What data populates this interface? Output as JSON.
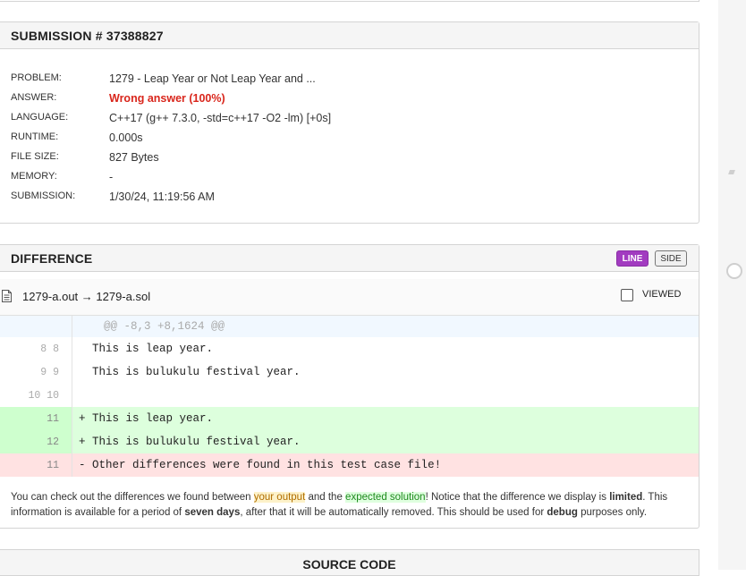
{
  "submission": {
    "title": "SUBMISSION # 37388827",
    "fields": [
      {
        "label": "PROBLEM:",
        "value": "1279 - Leap Year or Not Leap Year and ..."
      },
      {
        "label": "ANSWER:",
        "value": "Wrong answer (100%)"
      },
      {
        "label": "LANGUAGE:",
        "value": "C++17 (g++ 7.3.0, -std=c++17 -O2 -lm) [+0s]"
      },
      {
        "label": "RUNTIME:",
        "value": "0.000s"
      },
      {
        "label": "FILE SIZE:",
        "value": "827 Bytes"
      },
      {
        "label": "MEMORY:",
        "value": "-"
      },
      {
        "label": "SUBMISSION:",
        "value": "1/30/24, 11:19:56 AM"
      }
    ],
    "answer_color": "#d9261c"
  },
  "difference": {
    "title": "DIFFERENCE",
    "line_button": "LINE",
    "side_button": "SIDE",
    "file_label": "1279-a.out → 1279-a.sol",
    "viewed_label": "VIEWED",
    "hunk": "@@ -8,3 +8,1624 @@",
    "rows": [
      {
        "gutter": "8 8",
        "text": "  This is leap year."
      },
      {
        "gutter": "9 9",
        "text": "  This is bulukulu festival year."
      },
      {
        "gutter": "10 10",
        "text": ""
      },
      {
        "gutter": "11",
        "text": "+ This is leap year."
      },
      {
        "gutter": "12",
        "text": "+ This is bulukulu festival year."
      },
      {
        "gutter": "11",
        "text": "- Other differences were found in this test case file!"
      }
    ],
    "note": {
      "p1": "You can check out the differences we found between ",
      "your_output": "your output",
      "p2": " and the ",
      "expected": "expected solution",
      "p3": "! Notice that the difference we display is ",
      "limited": "limited",
      "p4": ". This information is available for a period of ",
      "seven_days": "seven days",
      "p5": ", after that it will be automatically removed. This should be used for ",
      "debug": "debug",
      "p6": " purposes only."
    },
    "colors": {
      "line_button": "#a23bc0",
      "added": "#ddffdd",
      "removed": "#ffe2e2"
    }
  },
  "source_code": {
    "title": "SOURCE CODE"
  },
  "icons": {
    "file": "document-icon",
    "checkbox": "checkbox-icon"
  }
}
